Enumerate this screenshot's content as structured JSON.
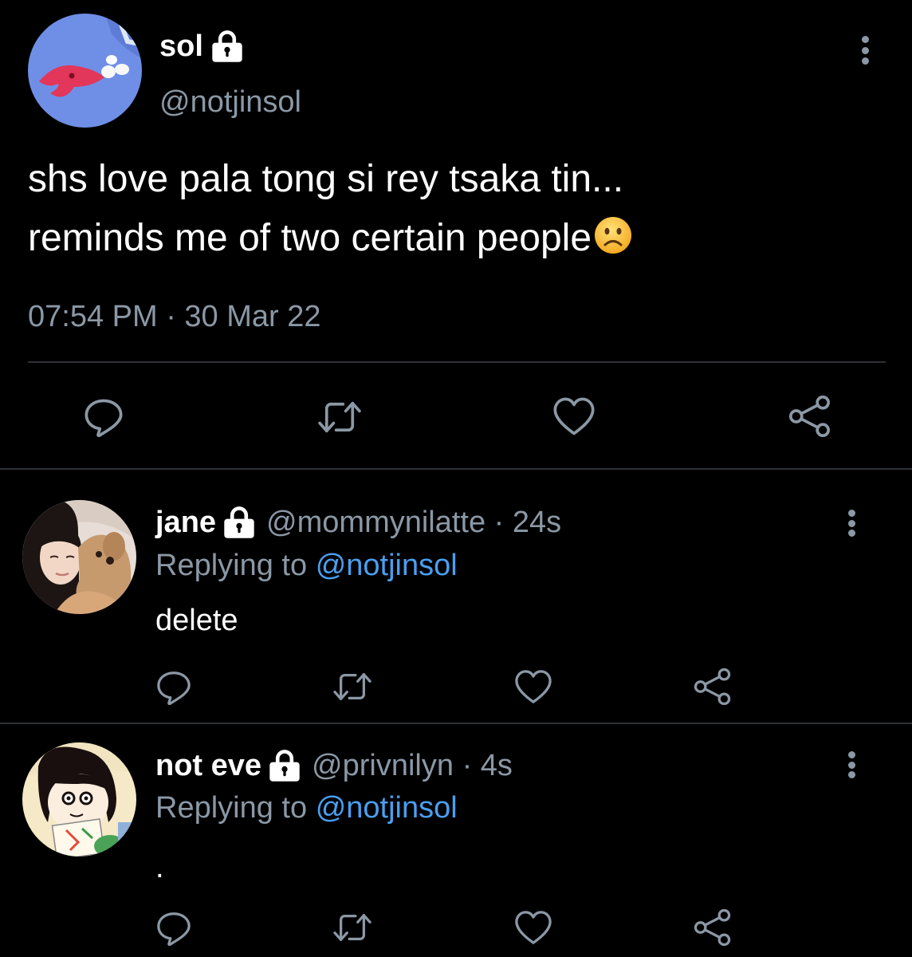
{
  "main_tweet": {
    "author_name": "sol",
    "author_handle": "@notjinsol",
    "text_line1": "shs love pala tong si rey tsaka tin...",
    "text_line2": "reminds me of two certain people",
    "emoji": "frowning-face",
    "timestamp": "07:54 PM · 30 Mar 22",
    "protected": true
  },
  "replies": [
    {
      "author_name": "jane",
      "handle_and_time": "@mommynilatte · 24s",
      "replying_label": "Replying to",
      "replying_mention": "@notjinsol",
      "text": "delete",
      "protected": true
    },
    {
      "author_name": "not eve",
      "handle_and_time": "@privnilyn · 4s",
      "replying_label": "Replying to",
      "replying_mention": "@notjinsol",
      "text": ".",
      "protected": true
    }
  ],
  "icons": [
    "lock-icon",
    "more-options-icon",
    "reply-icon",
    "retweet-icon",
    "like-icon",
    "share-icon"
  ],
  "colors": {
    "background": "#000000",
    "text_primary": "#ffffff",
    "text_secondary": "#8b98a5",
    "mention": "#4a9ff0",
    "divider": "#2f3336"
  }
}
